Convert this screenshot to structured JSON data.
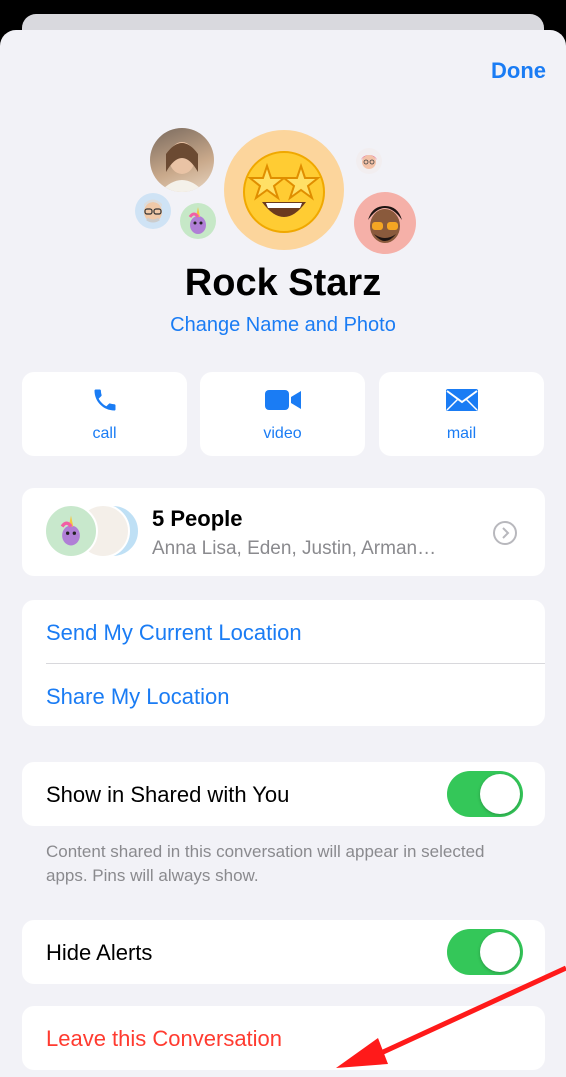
{
  "header": {
    "done_label": "Done"
  },
  "group": {
    "name": "Rock Starz",
    "change_link": "Change Name and Photo"
  },
  "actions": [
    {
      "label": "call",
      "icon": "phone-icon"
    },
    {
      "label": "video",
      "icon": "video-camera-icon"
    },
    {
      "label": "mail",
      "icon": "envelope-icon"
    }
  ],
  "people": {
    "title": "5 People",
    "subtitle": "Anna Lisa, Eden, Justin, Arman…"
  },
  "location": {
    "send_current": "Send My Current Location",
    "share": "Share My Location"
  },
  "shared_with_you": {
    "label": "Show in Shared with You",
    "enabled": true,
    "footnote": "Content shared in this conversation will appear in selected apps. Pins will always show."
  },
  "alerts": {
    "label": "Hide Alerts",
    "enabled": true
  },
  "leave": {
    "label": "Leave this Conversation"
  },
  "colors": {
    "accent": "#1a7cf4",
    "destructive": "#ff3b30",
    "toggle_on": "#34c759",
    "background": "#f2f2f7",
    "annotation_arrow": "#ff1a1a"
  }
}
